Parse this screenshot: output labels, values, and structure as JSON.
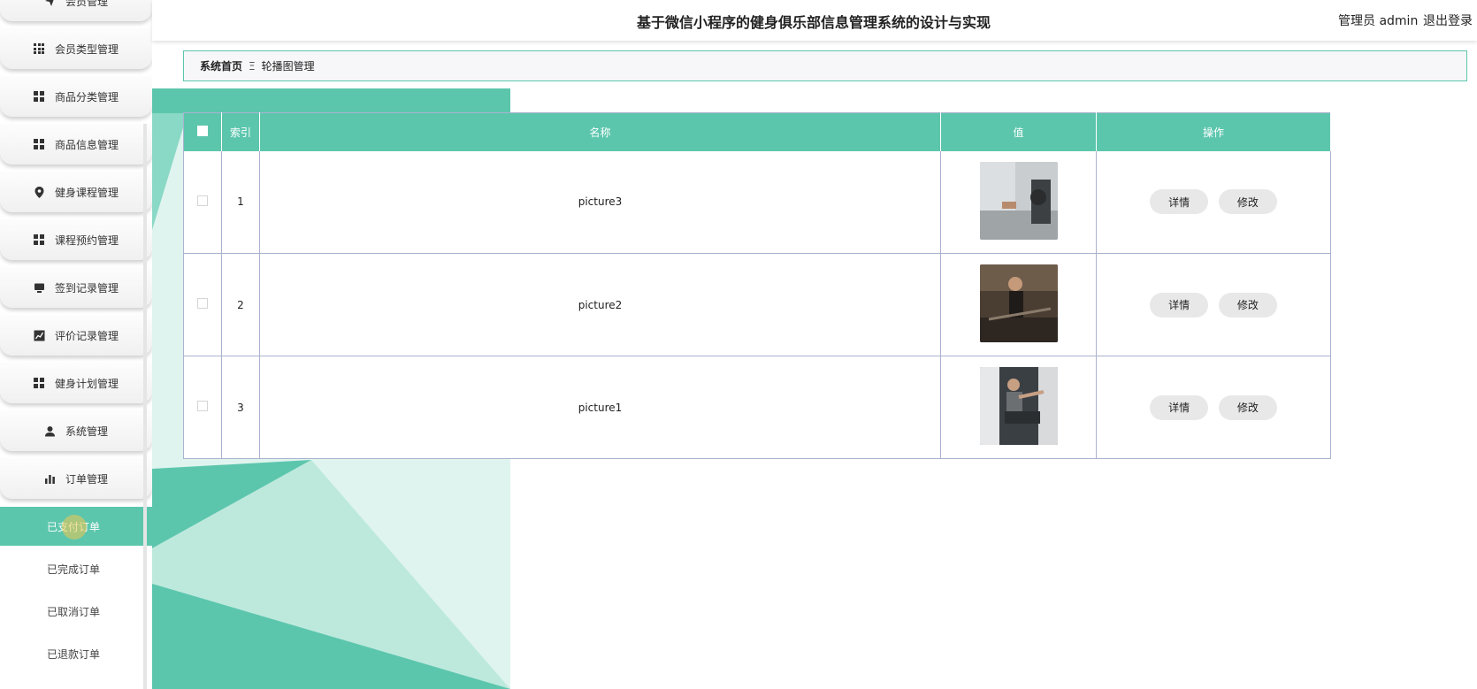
{
  "header": {
    "title": "基于微信小程序的健身俱乐部信息管理系统的设计与实现",
    "user": "管理员 admin",
    "logout": "退出登录"
  },
  "sidebar": {
    "items": [
      {
        "label": "会员管理",
        "icon": "paper-plane-icon"
      },
      {
        "label": "会员类型管理",
        "icon": "grid-icon"
      },
      {
        "label": "商品分类管理",
        "icon": "grid-icon"
      },
      {
        "label": "商品信息管理",
        "icon": "grid-icon"
      },
      {
        "label": "健身课程管理",
        "icon": "map-pin-icon"
      },
      {
        "label": "课程预约管理",
        "icon": "grid-icon"
      },
      {
        "label": "签到记录管理",
        "icon": "monitor-icon"
      },
      {
        "label": "评价记录管理",
        "icon": "line-chart-icon"
      },
      {
        "label": "健身计划管理",
        "icon": "grid-icon"
      },
      {
        "label": "系统管理",
        "icon": "user-icon"
      },
      {
        "label": "订单管理",
        "icon": "bar-chart-icon"
      }
    ],
    "sub_items": [
      {
        "label": "已支付订单",
        "active": true
      },
      {
        "label": "已完成订单",
        "active": false
      },
      {
        "label": "已取消订单",
        "active": false
      },
      {
        "label": "已退款订单",
        "active": false
      }
    ]
  },
  "breadcrumb": {
    "home": "系统首页",
    "separator": "Ξ",
    "current": "轮播图管理"
  },
  "table": {
    "columns": [
      "索引",
      "名称",
      "值",
      "操作"
    ],
    "rows": [
      {
        "index": "1",
        "name": "picture3",
        "image": "gym-photo-1"
      },
      {
        "index": "2",
        "name": "picture2",
        "image": "gym-photo-2"
      },
      {
        "index": "3",
        "name": "picture1",
        "image": "gym-photo-3"
      }
    ],
    "actions": {
      "detail": "详情",
      "edit": "修改"
    }
  },
  "colors": {
    "accent": "#5cc6ad",
    "table_border": "#aab2cf"
  }
}
